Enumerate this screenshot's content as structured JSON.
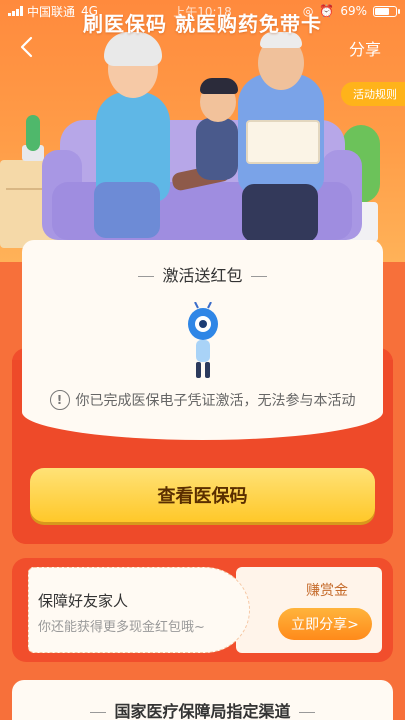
{
  "status_bar": {
    "carrier": "中国联通",
    "network": "4G",
    "time": "上午10:18",
    "battery": "69%",
    "battery_level": 0.69
  },
  "banner": {
    "title": "刷医保码 就医购药免带卡",
    "share": "分享",
    "rules": "活动规则"
  },
  "activate": {
    "title": "激活送红包",
    "notice": "你已完成医保电子凭证激活，无法参与本活动"
  },
  "view_button": "查看医保码",
  "share_card": {
    "title": "保障好友家人",
    "subtitle": "你还能获得更多现金红包哦~",
    "reward_label": "赚赏金",
    "share_button": "立即分享>"
  },
  "bottom": {
    "title": "国家医疗保障局指定渠道"
  },
  "colors": {
    "background": "#f7703a",
    "card_red": "#f14e2c",
    "button_yellow": "#ffc829",
    "share_orange": "#ff8a1a"
  }
}
